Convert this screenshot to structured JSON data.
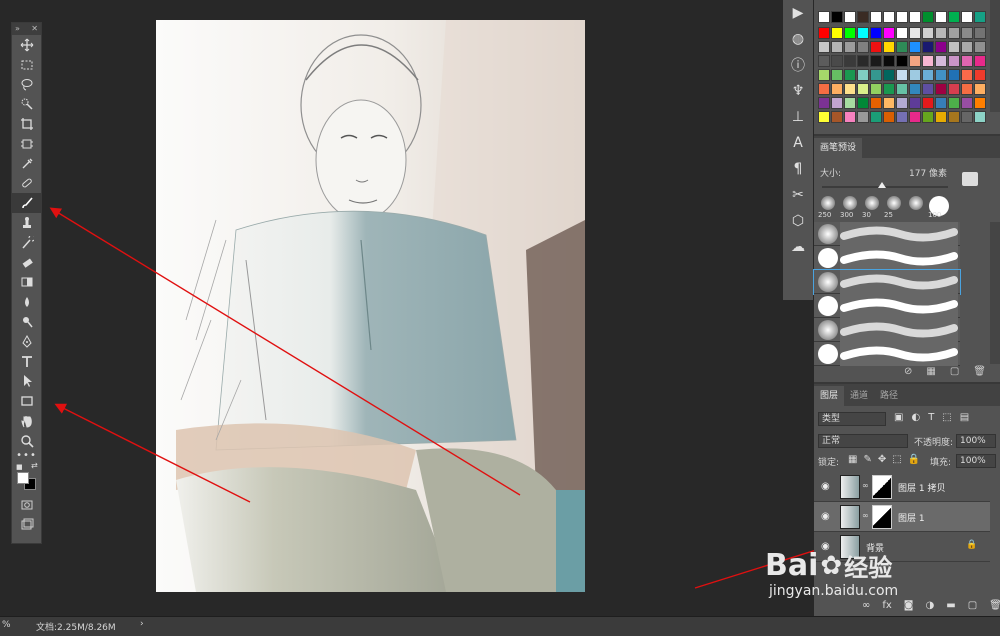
{
  "toolbar": {
    "collapse_label": "»",
    "close_label": "✕",
    "more_tools": "•••",
    "tools": [
      {
        "name": "move-tool",
        "icon": "move-icon"
      },
      {
        "name": "marquee-tool",
        "icon": "marquee-icon"
      },
      {
        "name": "lasso-tool",
        "icon": "lasso-icon"
      },
      {
        "name": "quick-select-tool",
        "icon": "quick-select-icon"
      },
      {
        "name": "crop-tool",
        "icon": "crop-icon"
      },
      {
        "name": "frame-tool",
        "icon": "frame-icon"
      },
      {
        "name": "eyedropper-tool",
        "icon": "eyedropper-icon"
      },
      {
        "name": "healing-brush-tool",
        "icon": "bandage-icon"
      },
      {
        "name": "brush-tool",
        "icon": "brush-icon",
        "active": true
      },
      {
        "name": "clone-stamp-tool",
        "icon": "stamp-icon"
      },
      {
        "name": "history-brush-tool",
        "icon": "history-brush-icon"
      },
      {
        "name": "eraser-tool",
        "icon": "eraser-icon"
      },
      {
        "name": "gradient-tool",
        "icon": "gradient-icon"
      },
      {
        "name": "blur-tool",
        "icon": "droplet-icon"
      },
      {
        "name": "dodge-tool",
        "icon": "dodge-icon"
      },
      {
        "name": "pen-tool",
        "icon": "pen-icon"
      },
      {
        "name": "type-tool",
        "icon": "type-icon"
      },
      {
        "name": "path-select-tool",
        "icon": "arrow-icon"
      },
      {
        "name": "rectangle-tool",
        "icon": "rectangle-icon"
      },
      {
        "name": "hand-tool",
        "icon": "hand-icon"
      },
      {
        "name": "zoom-tool",
        "icon": "zoom-icon"
      }
    ],
    "foreground_color": "#ffffff",
    "background_color": "#000000"
  },
  "status": {
    "doc_info": "文档:2.25M/8.26M",
    "arrow": "›",
    "left_glyph": "%"
  },
  "swatches_row1": [
    "#ffffff",
    "#000000",
    "#ffffff",
    "#3a2b24",
    "#ffffff",
    "#ffffff",
    "#ffffff",
    "#ffffff",
    "#008f2e",
    "#ffffff",
    "#00b050",
    "#ffffff",
    "#16a085"
  ],
  "swatch_grid": [
    [
      "#ff0000",
      "#ffff00",
      "#00ff00",
      "#00ffff",
      "#0000ff",
      "#ff00ff",
      "#ffffff",
      "#e6e6e6",
      "#cfcfcf",
      "#b8b8b8",
      "#a1a1a1",
      "#8a8a8a",
      "#737373"
    ],
    [
      "#c8c8c8",
      "#b4b4b4",
      "#9c9c9c",
      "#808080",
      "#ee1111",
      "#ffd700",
      "#2e8b57",
      "#1e90ff",
      "#191970",
      "#8b008b",
      "#c0c0c0",
      "#a9a9a9",
      "#909090"
    ],
    [
      "#5c5c5c",
      "#4a4a4a",
      "#3a3a3a",
      "#2a2a2a",
      "#1a1a1a",
      "#0a0a0a",
      "#000000",
      "#f4a582",
      "#f7b6d2",
      "#d4b9da",
      "#c994c7",
      "#df65b0",
      "#e7298a"
    ],
    [
      "#a6d96a",
      "#66bd63",
      "#1a9850",
      "#80cdc1",
      "#35978f",
      "#01665e",
      "#c6dbef",
      "#9ecae1",
      "#6baed6",
      "#4292c6",
      "#2171b5",
      "#fb6a4a",
      "#ef3b2c"
    ],
    [
      "#f46d43",
      "#fdae61",
      "#fee08b",
      "#d9ef8b",
      "#91cf60",
      "#1a9850",
      "#66c2a5",
      "#3288bd",
      "#5e4fa2",
      "#9e0142",
      "#d53e4f",
      "#f46d43",
      "#fdae61"
    ],
    [
      "#7b3294",
      "#c2a5cf",
      "#a6dba0",
      "#008837",
      "#e66101",
      "#fdb863",
      "#b2abd2",
      "#5e3c99",
      "#e41a1c",
      "#377eb8",
      "#4daf4a",
      "#984ea3",
      "#ff7f00"
    ],
    [
      "#ffff33",
      "#a65628",
      "#f781bf",
      "#999999",
      "#1b9e77",
      "#d95f02",
      "#7570b3",
      "#e7298a",
      "#66a61e",
      "#e6ab02",
      "#a6761d",
      "#666666",
      "#8dd3c7"
    ]
  ],
  "brushes": {
    "tab_label": "画笔预设",
    "size_label": "大小:",
    "size_value": "177 像素",
    "size_fraction": 0.48,
    "preset_sizes": [
      "250",
      "300",
      "30",
      "25",
      "",
      "100"
    ],
    "stroke_count": 6,
    "selected_stroke": 2
  },
  "layers": {
    "tabs": [
      "图层",
      "通道",
      "路径"
    ],
    "active_tab": 0,
    "kind_filter": "类型",
    "blend_mode": "正常",
    "opacity_label": "不透明度:",
    "opacity_value": "100%",
    "lock_label": "锁定:",
    "fill_label": "填充:",
    "fill_value": "100%",
    "items": [
      {
        "name": "图层 1 拷贝",
        "visible": true,
        "selected": false,
        "has_mask": true,
        "locked": false
      },
      {
        "name": "图层 1",
        "visible": true,
        "selected": true,
        "has_mask": true,
        "locked": false
      },
      {
        "name": "背景",
        "visible": true,
        "selected": false,
        "has_mask": false,
        "locked": true
      }
    ]
  },
  "watermark": {
    "brand_text": "Bai",
    "brand_suffix": "经验",
    "url": "jingyan.baidu.com"
  },
  "colors": {
    "annotation_arrow": "#e01010",
    "panel_bg": "#535353",
    "workspace_bg": "#282828"
  }
}
